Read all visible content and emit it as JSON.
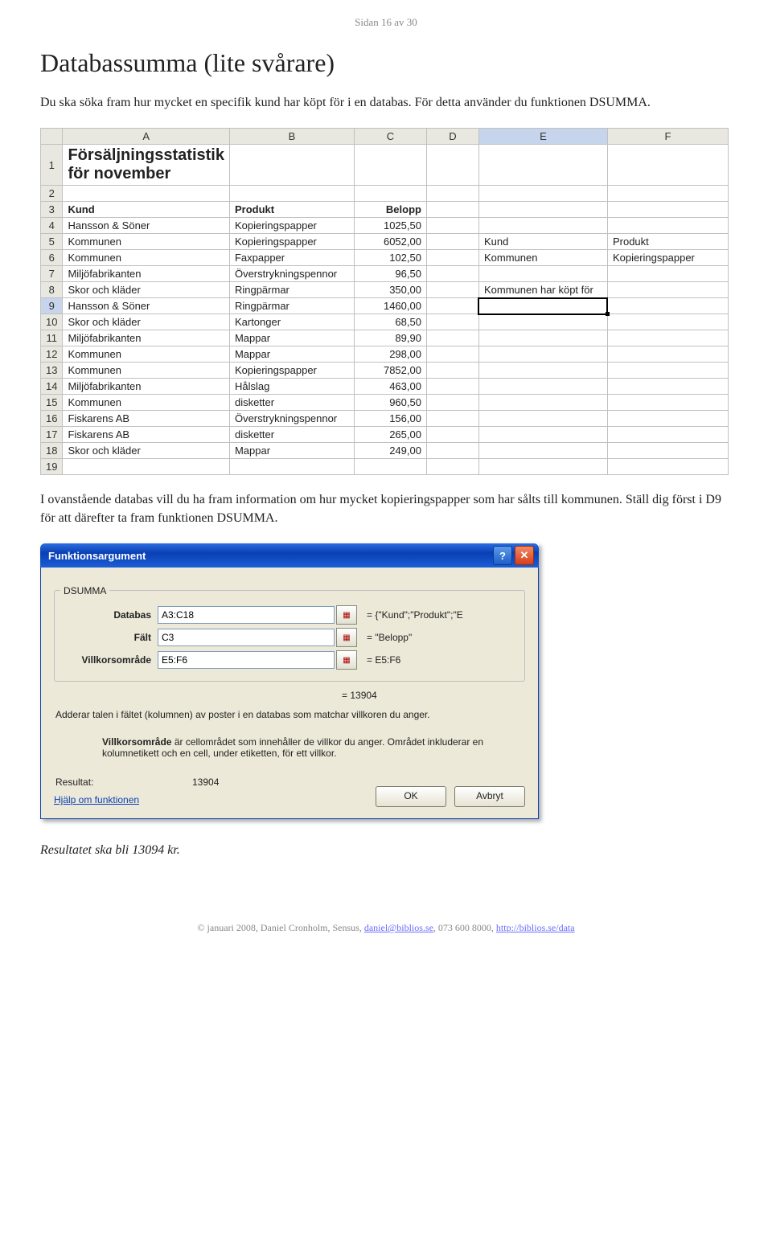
{
  "page_header": "Sidan 16 av 30",
  "title": "Databassumma (lite svårare)",
  "intro": "Du ska söka fram hur mycket en specifik kund har köpt för i en databas. För detta använder du funktionen DSUMMA.",
  "sheet": {
    "col_headers": [
      "A",
      "B",
      "C",
      "D",
      "E",
      "F"
    ],
    "selected_col_index": 4,
    "selected_row_index": 8,
    "rows": [
      {
        "n": 1,
        "A": "Försäljningsstatistik för november",
        "Aclass": "bigtitle"
      },
      {
        "n": 2
      },
      {
        "n": 3,
        "A": "Kund",
        "B": "Produkt",
        "C": "Belopp",
        "bold": true
      },
      {
        "n": 4,
        "A": "Hansson & Söner",
        "B": "Kopieringspapper",
        "C": "1025,50"
      },
      {
        "n": 5,
        "A": "Kommunen",
        "B": "Kopieringspapper",
        "C": "6052,00",
        "E": "Kund",
        "F": "Produkt"
      },
      {
        "n": 6,
        "A": "Kommunen",
        "B": "Faxpapper",
        "C": "102,50",
        "E": "Kommunen",
        "F": "Kopieringspapper"
      },
      {
        "n": 7,
        "A": "Miljöfabrikanten",
        "B": "Överstrykningspennor",
        "C": "96,50"
      },
      {
        "n": 8,
        "A": "Skor och kläder",
        "B": "Ringpärmar",
        "C": "350,00",
        "E": "Kommunen har köpt för"
      },
      {
        "n": 9,
        "A": "Hansson & Söner",
        "B": "Ringpärmar",
        "C": "1460,00",
        "Esel": true
      },
      {
        "n": 10,
        "A": "Skor och kläder",
        "B": "Kartonger",
        "C": "68,50"
      },
      {
        "n": 11,
        "A": "Miljöfabrikanten",
        "B": "Mappar",
        "C": "89,90"
      },
      {
        "n": 12,
        "A": "Kommunen",
        "B": "Mappar",
        "C": "298,00"
      },
      {
        "n": 13,
        "A": "Kommunen",
        "B": "Kopieringspapper",
        "C": "7852,00"
      },
      {
        "n": 14,
        "A": "Miljöfabrikanten",
        "B": "Hålslag",
        "C": "463,00"
      },
      {
        "n": 15,
        "A": "Kommunen",
        "B": "disketter",
        "C": "960,50"
      },
      {
        "n": 16,
        "A": "Fiskarens AB",
        "B": "Överstrykningspennor",
        "C": "156,00"
      },
      {
        "n": 17,
        "A": "Fiskarens AB",
        "B": "disketter",
        "C": "265,00"
      },
      {
        "n": 18,
        "A": "Skor och kläder",
        "B": "Mappar",
        "C": "249,00"
      },
      {
        "n": 19
      }
    ]
  },
  "mid_text": "I ovanstående databas vill du ha fram information om hur mycket kopieringspapper som har sålts till kommunen. Ställ dig först i D9 för att därefter ta fram funktionen DSUMMA.",
  "dialog": {
    "title": "Funktionsargument",
    "group": "DSUMMA",
    "args": [
      {
        "label": "Databas",
        "value": "A3:C18",
        "eval": "= {\"Kund\";\"Produkt\";\"E"
      },
      {
        "label": "Fält",
        "value": "C3",
        "eval": "= \"Belopp\""
      },
      {
        "label": "Villkorsområde",
        "value": "E5:F6",
        "eval": "= E5:F6"
      }
    ],
    "eq_result": "= 13904",
    "descr": "Adderar talen i fältet (kolumnen) av poster i en databas som matchar villkoren du anger.",
    "arg_help_bold": "Villkorsområde",
    "arg_help_rest": " är cellområdet som innehåller de villkor du anger. Området inkluderar en kolumnetikett och en cell, under etiketten, för ett villkor.",
    "result_label": "Resultat:",
    "result_value": "13904",
    "help_link": "Hjälp om funktionen",
    "ok": "OK",
    "cancel": "Avbryt"
  },
  "final": "Resultatet ska bli 13094 kr.",
  "footer": {
    "prefix": "© januari 2008, Daniel Cronholm, Sensus, ",
    "email": "daniel@biblios.se",
    "mid": ", 073 600 8000, ",
    "url": "http://biblios.se/data"
  }
}
